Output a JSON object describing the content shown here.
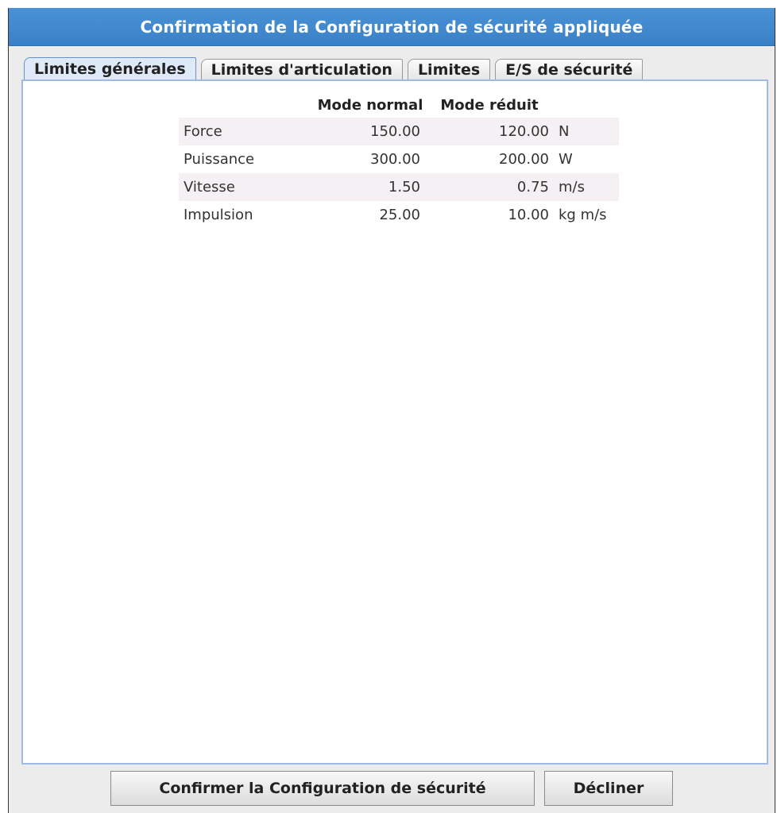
{
  "window": {
    "title": "Confirmation de la Configuration de sécurité appliquée"
  },
  "tabs": [
    {
      "label": "Limites générales",
      "active": true
    },
    {
      "label": "Limites d'articulation",
      "active": false
    },
    {
      "label": "Limites",
      "active": false
    },
    {
      "label": "E/S de sécurité",
      "active": false
    }
  ],
  "table": {
    "headers": [
      "",
      "Mode normal",
      "Mode réduit",
      ""
    ],
    "rows": [
      {
        "name": "Force",
        "normal": "150.00",
        "reduced": "120.00",
        "unit": "N"
      },
      {
        "name": "Puissance",
        "normal": "300.00",
        "reduced": "200.00",
        "unit": "W"
      },
      {
        "name": "Vitesse",
        "normal": "1.50",
        "reduced": "0.75",
        "unit": "m/s"
      },
      {
        "name": "Impulsion",
        "normal": "25.00",
        "reduced": "10.00",
        "unit": "kg m/s"
      }
    ]
  },
  "buttons": {
    "confirm_label": "Confirmer la Configuration de sécurité",
    "decline_label": "Décliner"
  },
  "colors": {
    "titlebar": "#3f86cd",
    "title_text": "#ffffff",
    "panel_border": "#9fbce0",
    "row_stripe": "#f4f0f3"
  }
}
